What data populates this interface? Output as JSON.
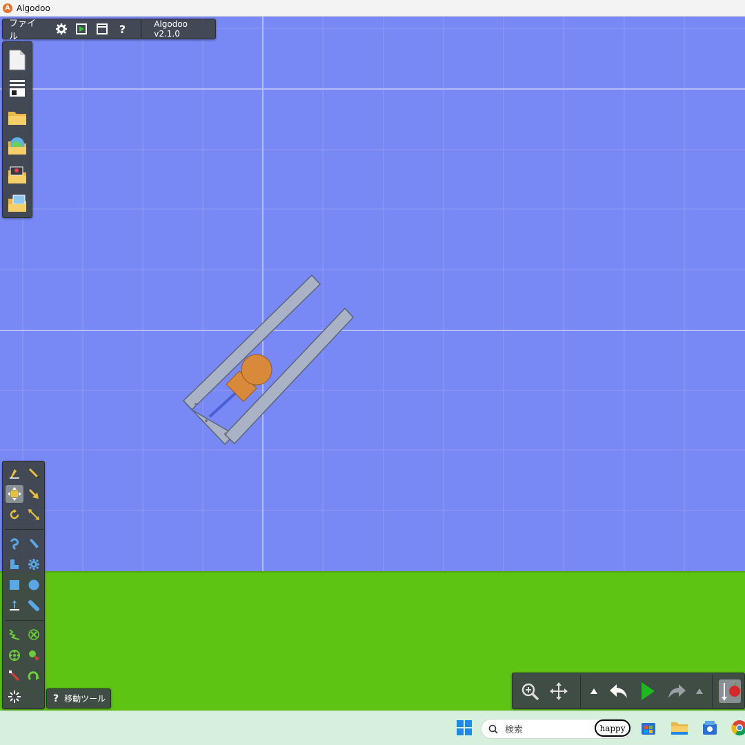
{
  "window": {
    "title": "Algodoo",
    "app_icon_letter": "A"
  },
  "menubar": {
    "file_label": "ファイル",
    "settings_icon": "gear-icon",
    "play_mode_icon": "play-window-icon",
    "window_icon": "window-icon",
    "help_label": "?",
    "version": "Algodoo v2.1.0"
  },
  "file_panel": {
    "items": [
      "new-scene-icon",
      "blank-scene-icon",
      "open-folder-icon",
      "open-scene-world-icon",
      "open-photo-folder-icon",
      "open-picture-folder-icon"
    ]
  },
  "tools": {
    "groups": [
      [
        "sketch-tool",
        "brush-tool",
        "move-tool",
        "drag-tool",
        "rotate-tool",
        "scale-tool"
      ],
      [
        "rope-tool",
        "knife-tool",
        "polygon-tool",
        "gear-tool",
        "box-tool",
        "circle-tool",
        "plane-tool",
        "chain-tool"
      ],
      [
        "spring-tool",
        "fixate-tool",
        "axle-tool",
        "tracer-tool",
        "laser-tool",
        "thruster-tool",
        "texture-tool"
      ]
    ],
    "selected": "move-tool"
  },
  "tooltip": {
    "icon": "?",
    "label": "移動ツール"
  },
  "simbar": {
    "buttons": [
      "zoom-icon",
      "pan-icon",
      "expand-up-icon",
      "undo-icon",
      "play-icon",
      "redo-icon",
      "expand-up-icon",
      "gravity-apple-icon"
    ]
  },
  "taskbar": {
    "search_placeholder": "検索",
    "search_badge": "happy",
    "icons": [
      "windows-start-icon",
      "store-icon",
      "file-explorer-icon",
      "weather-icon",
      "chrome-icon"
    ]
  },
  "colors": {
    "sky": "#7889f6",
    "ground": "#5ec414",
    "panel": "#3e4448",
    "orange": "#d9893a",
    "frame": "#aab3c6"
  }
}
